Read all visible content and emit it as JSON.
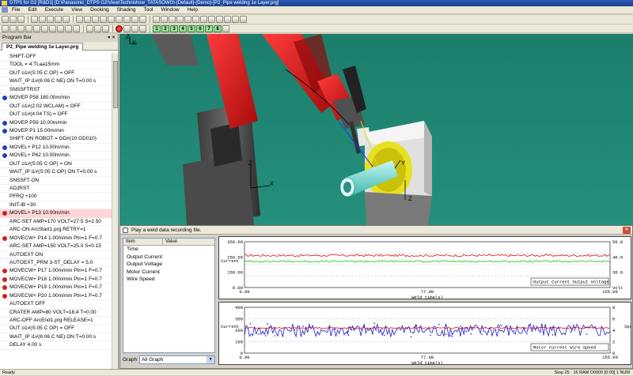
{
  "window": {
    "title": "DTPS for G2 [R&D1] [D:\\Panasonic_DTPS G2\\View\\Technishow_TATASOWG\\-[Default]-(Demo)-[P2_Pipe welding 1e Layer.prg]"
  },
  "menu": [
    "File",
    "Edit",
    "Execute",
    "View",
    "Docking",
    "Shading",
    "Tool",
    "Window",
    "Help"
  ],
  "toolbar": {
    "numbers": [
      "1",
      "2",
      "3",
      "4",
      "5",
      "6",
      "7",
      "8"
    ]
  },
  "program_bar": {
    "title": "Program Bar",
    "controls": "▾ ✕",
    "tab": "P2_Pipe welding 1e Layer.prg",
    "lines": [
      {
        "text": "SHIFT-OFF",
        "dot": ""
      },
      {
        "text": "TOOL = 4:TLaa15mm",
        "dot": ""
      },
      {
        "text": "OUT o1#(S:05 C OP) = OFF",
        "dot": ""
      },
      {
        "text": "WAIT_IP i1#(6:06 C NE) ON T=0.00 s",
        "dot": ""
      },
      {
        "text": "SNSSFTRST",
        "dot": ""
      },
      {
        "text": "MOVEP P58 180.00m/min",
        "dot": "#2040c0"
      },
      {
        "text": "OUT o1#(2:02 WCLAM) = OFF",
        "dot": ""
      },
      {
        "text": "OUT o1#(4:04 TS) = OFF",
        "dot": ""
      },
      {
        "text": "MOVEP P59 10.00m/min",
        "dot": "#2040c0"
      },
      {
        "text": "MOVEP P1 15.00m/min",
        "dot": "#2040c0"
      },
      {
        "text": "SHIFT-ON ROBOT = GD#(10:GD010)",
        "dot": ""
      },
      {
        "text": "MOVEL+ P12 10.00m/min",
        "dot": "#2040c0"
      },
      {
        "text": "MOVEL+ P62 10.00m/min",
        "dot": "#2040c0"
      },
      {
        "text": "OUT o1#(S:05 C OP) = ON",
        "dot": ""
      },
      {
        "text": "WAIT_IP i1#(S:05 C OP) ON T=0.00 s",
        "dot": ""
      },
      {
        "text": "SNSSFT-ON",
        "dot": ""
      },
      {
        "text": "ADJRST",
        "dot": ""
      },
      {
        "text": "PFRQ +100",
        "dot": ""
      },
      {
        "text": "INIT-IB +30",
        "dot": ""
      },
      {
        "text": "MOVEL+ P13 10.00m/min",
        "dot": "#d02020",
        "selected": true
      },
      {
        "text": "ARC-SET AMP=170 VOLT=27.5 S=2.50",
        "dot": ""
      },
      {
        "text": "ARC-ON ArcStart1.prg RETRY=1",
        "dot": ""
      },
      {
        "text": "MOVECW+ P14 1.00m/min Ptn=1 F=0.7",
        "dot": "#d02020"
      },
      {
        "text": "ARC-SET AMP=150 VOLT=25.0 S=0.15",
        "dot": ""
      },
      {
        "text": "AUTOEXT ON",
        "dot": ""
      },
      {
        "text": "AUTOEXT_PRM 3-ST_DELAY = 5.0",
        "dot": ""
      },
      {
        "text": "MOVECW+ P17 1.00m/min Ptn=1 F=0.7",
        "dot": "#d02020"
      },
      {
        "text": "MOVECW+ P18 1.00m/min Ptn=1 F=0.7",
        "dot": "#d02020"
      },
      {
        "text": "MOVECW+ P19 1.00m/min Ptn=1 F=0.7",
        "dot": "#d02020"
      },
      {
        "text": "MOVECW+ P20 1.00m/min Ptn=1 F=0.7",
        "dot": "#d02020"
      },
      {
        "text": "AUTOEXT OFF",
        "dot": ""
      },
      {
        "text": "CRATER AMP=80 VOLT=18.4 T=0.00",
        "dot": ""
      },
      {
        "text": "ARC-OFF ArcEnd1.prg RELEASE=1",
        "dot": ""
      },
      {
        "text": "OUT o1#(S:05 C OP) = OFF",
        "dot": ""
      },
      {
        "text": "WAIT_IP i1#(6:06 C NE) ON T=0.00 s",
        "dot": ""
      },
      {
        "text": "DELAY 4.00 s",
        "dot": ""
      }
    ]
  },
  "viewport": {
    "axes": {
      "x": "X",
      "y": "Y",
      "z": "Z"
    }
  },
  "dialog": {
    "title": "Play a weld data recording file.",
    "close": "✕",
    "columns": [
      "Item",
      "Value"
    ],
    "items": [
      "Time",
      "Output Current",
      "Output Voltage",
      "Motor Current",
      "Wire Speed"
    ],
    "graph_label": "Graph",
    "graph_value": "All Graph",
    "graph_arrow": "▼"
  },
  "chart_data": [
    {
      "type": "line",
      "ylim_left": [
        0,
        350
      ],
      "left_ticks": [
        "350.00",
        "250.00",
        "150.00",
        "0.00"
      ],
      "ylim_right": [
        0,
        50
      ],
      "right_ticks": [
        "50.0",
        "40.0",
        "30.0",
        "Volt"
      ],
      "left_axis_label": "Current",
      "x_ticks": [
        "0.00",
        "77.00",
        "155.00"
      ],
      "xlabel": "Weld time(s)",
      "legend": "Output Current  Output Voltage",
      "series": [
        {
          "name": "Output Current",
          "color": "#d01010",
          "mean": 245,
          "spread": 8
        },
        {
          "name": "Output Voltage",
          "color": "#10c010",
          "mean": 200,
          "spread": 6
        }
      ],
      "xlim": [
        0,
        155
      ]
    },
    {
      "type": "line",
      "ylim_left": [
        0,
        400
      ],
      "left_ticks": [
        "400",
        "300",
        "200",
        "100",
        "0"
      ],
      "ylim_right": [
        0,
        8
      ],
      "right_ticks": [
        "8",
        "6",
        "4",
        "2",
        "0"
      ],
      "left_axis_label": "Current",
      "right_axis_label": "Spe",
      "x_ticks": [
        "0.00",
        "77.00",
        "155.00"
      ],
      "xlabel": "Weld time(s)",
      "legend": "Motor Current  Wire Speed",
      "series": [
        {
          "name": "Motor Current",
          "color": "#2020d0",
          "mean": 200,
          "spread": 60
        },
        {
          "name": "Wire Speed",
          "color": "#d01010",
          "mean": 220,
          "spread": 6
        }
      ],
      "xlim": [
        0,
        155
      ]
    }
  ],
  "statusbar": {
    "left": "Ready",
    "right": "Stop   25 · 16 RAM   D0000   [0:00]   1   NUM"
  }
}
